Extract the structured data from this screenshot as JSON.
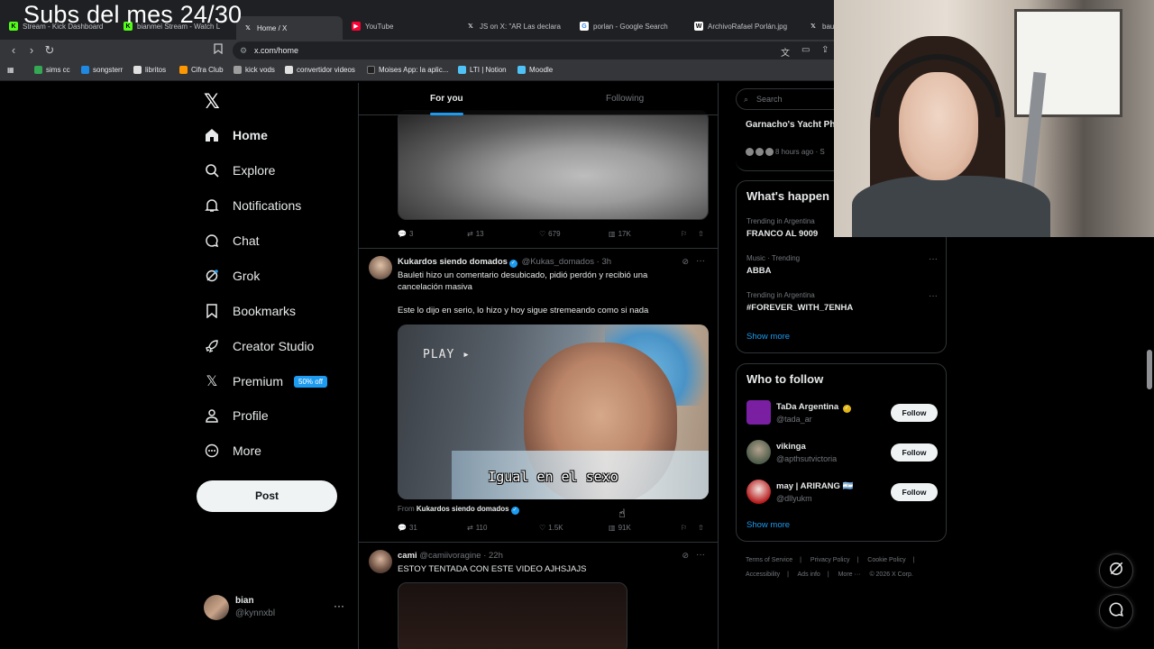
{
  "overlay": {
    "title": "Subs del mes 24/30"
  },
  "browser": {
    "tabs": [
      {
        "label": "Stream - Kick Dashboard",
        "favicon_color": "#53fc18"
      },
      {
        "label": "bianmei Stream - Watch L",
        "favicon_color": "#53fc18"
      },
      {
        "label": "Home / X",
        "favicon_color": "#ffffff"
      },
      {
        "label": "YouTube",
        "favicon_color": "#ff0033"
      },
      {
        "label": "JS on X: \"AR Las declara",
        "favicon_color": "#ffffff"
      },
      {
        "label": "porlan - Google Search",
        "favicon_color": "#4285f4"
      },
      {
        "label": "ArchivoRafael Porlán.jpg",
        "favicon_color": "#ffffff"
      },
      {
        "label": "bau",
        "favicon_color": "#ffffff"
      }
    ],
    "url": "x.com/home",
    "bookmarks": [
      {
        "label": "sims cc",
        "color": "#34a853"
      },
      {
        "label": "songsterr",
        "color": "#1e88e5"
      },
      {
        "label": "libritos",
        "color": "#e0e0e0"
      },
      {
        "label": "Cifra Club",
        "color": "#ff9800"
      },
      {
        "label": "kick vods",
        "color": "#9e9e9e"
      },
      {
        "label": "convertidor videos",
        "color": "#e0e0e0"
      },
      {
        "label": "Moises App: la aplic...",
        "color": "#212121"
      },
      {
        "label": "LTI | Notion",
        "color": "#4fc3f7"
      },
      {
        "label": "Moodle",
        "color": "#4fc3f7"
      }
    ]
  },
  "nav": {
    "items": [
      {
        "label": "Home",
        "icon": "home-icon"
      },
      {
        "label": "Explore",
        "icon": "search-icon"
      },
      {
        "label": "Notifications",
        "icon": "bell-icon"
      },
      {
        "label": "Chat",
        "icon": "chat-icon"
      },
      {
        "label": "Grok",
        "icon": "grok-icon"
      },
      {
        "label": "Bookmarks",
        "icon": "bookmark-icon"
      },
      {
        "label": "Creator Studio",
        "icon": "rocket-icon"
      },
      {
        "label": "Premium",
        "icon": "x-icon"
      },
      {
        "label": "Profile",
        "icon": "person-icon"
      },
      {
        "label": "More",
        "icon": "more-circle-icon"
      }
    ],
    "premium_badge": "50% off",
    "post_label": "Post",
    "account": {
      "name": "bian",
      "handle": "@kynnxbl"
    }
  },
  "feed": {
    "tabs": {
      "for_you": "For you",
      "following": "Following"
    },
    "tweet1": {
      "replies": "3",
      "reposts": "13",
      "likes": "679",
      "views": "17K"
    },
    "tweet2": {
      "name": "Kukardos siendo domados",
      "handle": "@Kukas_domados",
      "time": "· 3h",
      "text1": "Bauleti hizo un comentario desubicado, pidió perdón y recibió una cancelación masiva",
      "text2": "Este lo dijo en serio, lo hizo y hoy sigue stremeando como si nada",
      "video_play": "PLAY ▸",
      "video_subtitle": "Igual en el sexo",
      "from_label": "From",
      "from_name": "Kukardos siendo domados",
      "replies": "31",
      "reposts": "110",
      "likes": "1.5K",
      "views": "91K"
    },
    "tweet3": {
      "name": "cami",
      "handle": "@camiivoragine",
      "time": "· 22h",
      "text": "ESTOY TENTADA CON ESTE VIDEO AJHSJAJS"
    }
  },
  "sidebar": {
    "search_placeholder": "Search",
    "news": {
      "title": "Garnacho's Yacht Ph Jokes on Social Med",
      "meta": "8 hours ago · S"
    },
    "trends_title": "What's happen",
    "trends": [
      {
        "context": "Trending in Argentina",
        "name": "FRANCO AL 9009"
      },
      {
        "context": "Music · Trending",
        "name": "ABBA"
      },
      {
        "context": "Trending in Argentina",
        "name": "#FOREVER_WITH_7ENHA"
      }
    ],
    "show_more": "Show more",
    "who_to_follow_title": "Who to follow",
    "who_to_follow": [
      {
        "name": "TaDa Argentina",
        "handle": "@tada_ar",
        "color": "#7b1fa2"
      },
      {
        "name": "vikinga",
        "handle": "@apthsutvictoria",
        "color": "#4e5d4a"
      },
      {
        "name": "may | ARIRANG 🇦🇷",
        "handle": "@dllyukm",
        "color": "#b71c1c"
      }
    ],
    "follow_label": "Follow",
    "footer": [
      "Terms of Service",
      "|",
      "Privacy Policy",
      "|",
      "Cookie Policy",
      "|",
      "Accessibility",
      "|",
      "Ads info",
      "|",
      "More ···",
      "© 2026 X Corp."
    ]
  },
  "colors": {
    "accent": "#1d9bf0",
    "background": "#000000",
    "border": "#2f3336"
  }
}
